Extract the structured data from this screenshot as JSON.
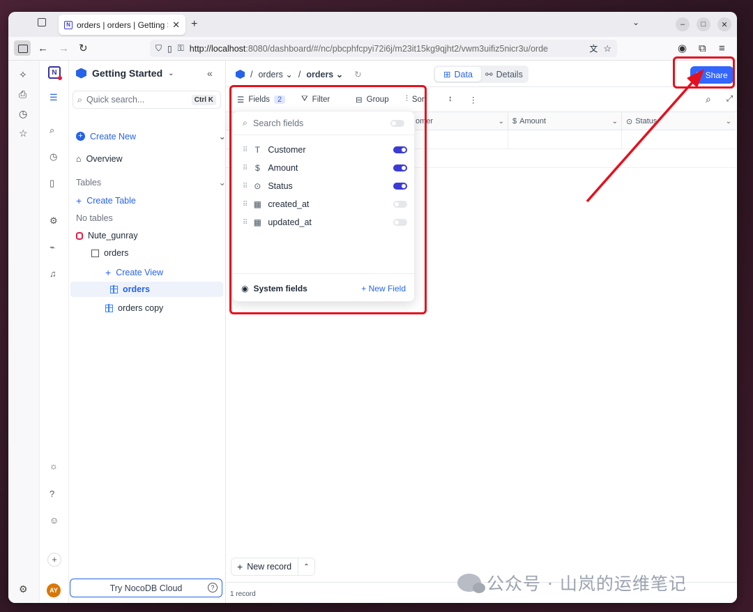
{
  "browser": {
    "tab_title": "orders | orders | Getting S",
    "new_tab": "+",
    "url_host": "http://localhost",
    "url_rest": ":8080/dashboard/#/nc/pbcphfcpyi72i6j/m23it15kg9qjht2/vwm3uifiz5nicr3u/orde"
  },
  "sidebar": {
    "project_name": "Getting Started",
    "search_placeholder": "Quick search...",
    "search_shortcut": "Ctrl K",
    "create_new": "Create New",
    "overview": "Overview",
    "tables_heading": "Tables",
    "create_table": "Create Table",
    "no_tables": "No tables",
    "source_name": "Nute_gunray",
    "table_name": "orders",
    "create_view": "Create View",
    "views": [
      "orders",
      "orders copy"
    ],
    "try_cloud": "Try NocoDB Cloud",
    "avatar_initials": "AY"
  },
  "topbar": {
    "breadcrumb_sep": "/",
    "crumb_table": "orders",
    "crumb_view": "orders",
    "tab_data": "Data",
    "tab_details": "Details",
    "share": "Share"
  },
  "toolbar": {
    "fields": "Fields",
    "fields_count": "2",
    "filter": "Filter",
    "group": "Group",
    "sort": "Sort"
  },
  "grid": {
    "columns": [
      "omer",
      "Amount",
      "Status"
    ],
    "new_record": "New record",
    "record_count": "1 record"
  },
  "fields_popup": {
    "search_placeholder": "Search fields",
    "fields": [
      {
        "name": "Customer",
        "icon": "text-icon",
        "visible": true
      },
      {
        "name": "Amount",
        "icon": "currency-icon",
        "visible": true
      },
      {
        "name": "Status",
        "icon": "single-select-icon",
        "visible": true
      },
      {
        "name": "created_at",
        "icon": "calendar-icon",
        "visible": false
      },
      {
        "name": "updated_at",
        "icon": "calendar-icon",
        "visible": false
      }
    ],
    "system_fields": "System fields",
    "new_field": "New Field"
  },
  "watermark": "公众号 · 山岚的运维笔记",
  "colors": {
    "accent": "#3366ff",
    "highlight": "#e5101d"
  }
}
